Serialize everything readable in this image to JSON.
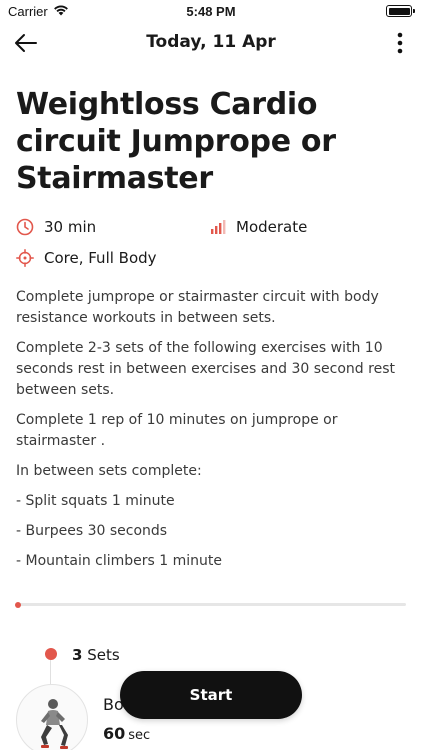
{
  "status_bar": {
    "carrier": "Carrier",
    "time": "5:48 PM",
    "icons": [
      "wifi-icon",
      "battery-icon"
    ]
  },
  "nav": {
    "title": "Today, 11 Apr",
    "back_icon": "arrow-left-icon",
    "more_icon": "more-vertical-icon"
  },
  "workout": {
    "title": "Weightloss Cardio circuit Jumprope or Stairmaster",
    "duration": "30 min",
    "intensity": "Moderate",
    "focus": "Core, Full Body",
    "description": [
      "Complete jumprope or stairmaster circuit with body resistance workouts in between sets.",
      "Complete 2-3 sets of the following exercises with 10 seconds rest in between exercises and 30 second rest between sets.",
      "Complete 1 rep of 10 minutes on jumprope or stairmaster .",
      "In between sets complete:",
      "- Split squats 1 minute",
      "- Burpees 30 seconds",
      "- Mountain climbers 1 minute"
    ],
    "progress": 0.01
  },
  "sets": {
    "count": "3",
    "label": "Sets"
  },
  "exercise": {
    "name": "Bo",
    "duration_value": "60",
    "duration_unit": "sec"
  },
  "start_label": "Start",
  "colors": {
    "accent": "#e2574c",
    "button_bg": "#111111",
    "button_text": "#ffffff"
  }
}
